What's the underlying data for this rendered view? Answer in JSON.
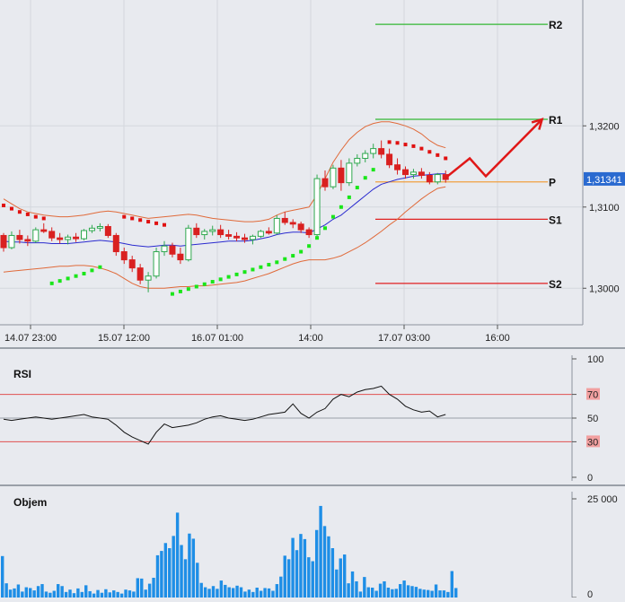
{
  "colors": {
    "background": "#e8eaef",
    "axis_bg": "#e8eaef",
    "grid": "#d4d7dd",
    "candle_up": "#2fa84f",
    "candle_down": "#d92020",
    "ma": "#2a2acf",
    "band": "#e06a3a",
    "sar_up": "#19e619",
    "sar_down": "#e01010",
    "pivot": "#f0a040",
    "resistance": "#33b833",
    "support": "#e02020",
    "arrow": "#e01818",
    "last_price_bg": "#2a6ad0",
    "rsi_line": "#111111",
    "rsi_level": "#e05050",
    "volume": "#1e8ee6"
  },
  "chart_data": [
    {
      "type": "candlestick",
      "name": "price-panel",
      "yticks": [
        "1,3200",
        "1,3100",
        "1,3000"
      ],
      "ylim": [
        1.2955,
        1.3355
      ],
      "last_price_label": "1,31341",
      "last_price": 1.31341,
      "xticks": [
        "14.07 23:00",
        "15.07 12:00",
        "16.07 01:00",
        "14:00",
        "17.07 03:00",
        "16:00"
      ],
      "pivot_levels": [
        {
          "label": "R2",
          "value": 1.3325,
          "kind": "resistance"
        },
        {
          "label": "R1",
          "value": 1.3208,
          "kind": "resistance"
        },
        {
          "label": "P",
          "value": 1.3131,
          "kind": "pivot"
        },
        {
          "label": "S1",
          "value": 1.3085,
          "kind": "support"
        },
        {
          "label": "S2",
          "value": 1.3006,
          "kind": "support"
        }
      ],
      "candles": [
        [
          1.3065,
          1.3068,
          1.3045,
          1.305
        ],
        [
          1.305,
          1.307,
          1.3048,
          1.3065
        ],
        [
          1.3065,
          1.3072,
          1.3055,
          1.306
        ],
        [
          1.306,
          1.3065,
          1.3052,
          1.3058
        ],
        [
          1.3058,
          1.3075,
          1.3056,
          1.3072
        ],
        [
          1.3072,
          1.308,
          1.3068,
          1.307
        ],
        [
          1.307,
          1.3075,
          1.3058,
          1.3062
        ],
        [
          1.3062,
          1.3068,
          1.3055,
          1.306
        ],
        [
          1.306,
          1.3066,
          1.3054,
          1.3063
        ],
        [
          1.3063,
          1.3068,
          1.3057,
          1.3061
        ],
        [
          1.3061,
          1.3073,
          1.3059,
          1.3071
        ],
        [
          1.3071,
          1.3078,
          1.3068,
          1.3074
        ],
        [
          1.3074,
          1.308,
          1.307,
          1.3076
        ],
        [
          1.3076,
          1.3079,
          1.3062,
          1.3065
        ],
        [
          1.3065,
          1.3068,
          1.304,
          1.3045
        ],
        [
          1.3045,
          1.305,
          1.303,
          1.3035
        ],
        [
          1.3035,
          1.304,
          1.302,
          1.3025
        ],
        [
          1.3025,
          1.303,
          1.3005,
          1.301
        ],
        [
          1.301,
          1.302,
          1.2995,
          1.3015
        ],
        [
          1.3015,
          1.305,
          1.3012,
          1.3045
        ],
        [
          1.3045,
          1.3058,
          1.304,
          1.3052
        ],
        [
          1.3052,
          1.3056,
          1.3038,
          1.3042
        ],
        [
          1.3042,
          1.305,
          1.303,
          1.3035
        ],
        [
          1.3035,
          1.3078,
          1.3033,
          1.3074
        ],
        [
          1.3074,
          1.308,
          1.3062,
          1.3066
        ],
        [
          1.3066,
          1.3073,
          1.306,
          1.307
        ],
        [
          1.307,
          1.3077,
          1.3065,
          1.3072
        ],
        [
          1.3072,
          1.3078,
          1.3062,
          1.3066
        ],
        [
          1.3066,
          1.3072,
          1.306,
          1.3064
        ],
        [
          1.3064,
          1.3069,
          1.3058,
          1.3062
        ],
        [
          1.3062,
          1.3067,
          1.3056,
          1.306
        ],
        [
          1.306,
          1.3066,
          1.3054,
          1.3064
        ],
        [
          1.3064,
          1.3072,
          1.3062,
          1.307
        ],
        [
          1.307,
          1.3075,
          1.3066,
          1.3068
        ],
        [
          1.3068,
          1.309,
          1.3066,
          1.3086
        ],
        [
          1.3086,
          1.3094,
          1.3078,
          1.3081
        ],
        [
          1.3081,
          1.3085,
          1.3074,
          1.3079
        ],
        [
          1.3079,
          1.3082,
          1.3068,
          1.3072
        ],
        [
          1.3072,
          1.3075,
          1.3062,
          1.3066
        ],
        [
          1.3066,
          1.314,
          1.3064,
          1.3135
        ],
        [
          1.3135,
          1.3145,
          1.312,
          1.3125
        ],
        [
          1.3125,
          1.3152,
          1.3122,
          1.3148
        ],
        [
          1.3148,
          1.3158,
          1.312,
          1.313
        ],
        [
          1.313,
          1.316,
          1.3126,
          1.3154
        ],
        [
          1.3154,
          1.3165,
          1.315,
          1.316
        ],
        [
          1.316,
          1.317,
          1.3155,
          1.3166
        ],
        [
          1.3166,
          1.3178,
          1.316,
          1.3172
        ],
        [
          1.3172,
          1.3182,
          1.316,
          1.3165
        ],
        [
          1.3165,
          1.3172,
          1.3148,
          1.3152
        ],
        [
          1.3152,
          1.316,
          1.314,
          1.3146
        ],
        [
          1.3146,
          1.315,
          1.3135,
          1.314
        ],
        [
          1.314,
          1.3147,
          1.3135,
          1.3143
        ],
        [
          1.3143,
          1.3148,
          1.3135,
          1.3139
        ],
        [
          1.3139,
          1.3143,
          1.3128,
          1.3131
        ],
        [
          1.3131,
          1.3142,
          1.3128,
          1.314
        ],
        [
          1.314,
          1.3145,
          1.313,
          1.3134
        ]
      ],
      "moving_average": [
        1.3058,
        1.3057,
        1.3057,
        1.3056,
        1.3056,
        1.3056,
        1.3055,
        1.3055,
        1.3055,
        1.3056,
        1.3057,
        1.3058,
        1.3059,
        1.3058,
        1.3057,
        1.3055,
        1.3053,
        1.3052,
        1.3051,
        1.3052,
        1.3053,
        1.3053,
        1.3052,
        1.3053,
        1.3054,
        1.3055,
        1.3056,
        1.3057,
        1.3058,
        1.3058,
        1.3058,
        1.3059,
        1.3061,
        1.3063,
        1.3066,
        1.3068,
        1.3069,
        1.3069,
        1.3068,
        1.3073,
        1.3078,
        1.3085,
        1.309,
        1.3098,
        1.3106,
        1.3114,
        1.3122,
        1.3128,
        1.3131,
        1.3134,
        1.3136,
        1.3138,
        1.3139,
        1.314,
        1.3141,
        1.3141
      ],
      "band_upper": [
        1.311,
        1.3104,
        1.3098,
        1.3094,
        1.3092,
        1.309,
        1.3089,
        1.3088,
        1.3088,
        1.3089,
        1.309,
        1.3092,
        1.3094,
        1.3095,
        1.3094,
        1.3092,
        1.309,
        1.3088,
        1.3086,
        1.3087,
        1.3088,
        1.3089,
        1.309,
        1.3091,
        1.309,
        1.3088,
        1.3086,
        1.3085,
        1.3084,
        1.3083,
        1.3082,
        1.3082,
        1.3083,
        1.3085,
        1.309,
        1.3094,
        1.3096,
        1.3098,
        1.31,
        1.3115,
        1.3135,
        1.3155,
        1.317,
        1.3183,
        1.3192,
        1.3199,
        1.3203,
        1.3205,
        1.3205,
        1.3203,
        1.32,
        1.3196,
        1.319,
        1.3182,
        1.3176,
        1.3173
      ],
      "band_lower": [
        1.302,
        1.3021,
        1.3022,
        1.3023,
        1.3024,
        1.3025,
        1.3026,
        1.3027,
        1.3027,
        1.3028,
        1.3028,
        1.3027,
        1.3025,
        1.3022,
        1.3018,
        1.3012,
        1.3006,
        1.3002,
        1.3,
        1.3,
        1.3,
        1.3001,
        1.3002,
        1.3002,
        1.3003,
        1.3003,
        1.3004,
        1.3005,
        1.3006,
        1.3007,
        1.3009,
        1.3012,
        1.3015,
        1.3018,
        1.3022,
        1.3026,
        1.303,
        1.3033,
        1.3035,
        1.3035,
        1.3035,
        1.3037,
        1.304,
        1.3045,
        1.305,
        1.3056,
        1.3063,
        1.307,
        1.3078,
        1.3085,
        1.3094,
        1.3102,
        1.311,
        1.3117,
        1.3123,
        1.3125
      ],
      "parabolic_sar": [
        {
          "i": 0,
          "v": 1.3102,
          "dir": "down"
        },
        {
          "i": 1,
          "v": 1.3098,
          "dir": "down"
        },
        {
          "i": 2,
          "v": 1.3094,
          "dir": "down"
        },
        {
          "i": 3,
          "v": 1.3091,
          "dir": "down"
        },
        {
          "i": 4,
          "v": 1.3088,
          "dir": "down"
        },
        {
          "i": 5,
          "v": 1.3086,
          "dir": "down"
        },
        {
          "i": 6,
          "v": 1.3006,
          "dir": "up"
        },
        {
          "i": 7,
          "v": 1.3009,
          "dir": "up"
        },
        {
          "i": 8,
          "v": 1.3012,
          "dir": "up"
        },
        {
          "i": 9,
          "v": 1.3015,
          "dir": "up"
        },
        {
          "i": 10,
          "v": 1.3018,
          "dir": "up"
        },
        {
          "i": 11,
          "v": 1.3022,
          "dir": "up"
        },
        {
          "i": 12,
          "v": 1.3026,
          "dir": "up"
        },
        {
          "i": 15,
          "v": 1.3088,
          "dir": "down"
        },
        {
          "i": 16,
          "v": 1.3086,
          "dir": "down"
        },
        {
          "i": 17,
          "v": 1.3084,
          "dir": "down"
        },
        {
          "i": 18,
          "v": 1.3082,
          "dir": "down"
        },
        {
          "i": 19,
          "v": 1.308,
          "dir": "down"
        },
        {
          "i": 20,
          "v": 1.3078,
          "dir": "down"
        },
        {
          "i": 21,
          "v": 1.2993,
          "dir": "up"
        },
        {
          "i": 22,
          "v": 1.2996,
          "dir": "up"
        },
        {
          "i": 23,
          "v": 1.2999,
          "dir": "up"
        },
        {
          "i": 24,
          "v": 1.3002,
          "dir": "up"
        },
        {
          "i": 25,
          "v": 1.3005,
          "dir": "up"
        },
        {
          "i": 26,
          "v": 1.3008,
          "dir": "up"
        },
        {
          "i": 27,
          "v": 1.3011,
          "dir": "up"
        },
        {
          "i": 28,
          "v": 1.3014,
          "dir": "up"
        },
        {
          "i": 29,
          "v": 1.3017,
          "dir": "up"
        },
        {
          "i": 30,
          "v": 1.302,
          "dir": "up"
        },
        {
          "i": 31,
          "v": 1.3023,
          "dir": "up"
        },
        {
          "i": 32,
          "v": 1.3026,
          "dir": "up"
        },
        {
          "i": 33,
          "v": 1.3029,
          "dir": "up"
        },
        {
          "i": 34,
          "v": 1.3032,
          "dir": "up"
        },
        {
          "i": 35,
          "v": 1.3036,
          "dir": "up"
        },
        {
          "i": 36,
          "v": 1.304,
          "dir": "up"
        },
        {
          "i": 37,
          "v": 1.3045,
          "dir": "up"
        },
        {
          "i": 38,
          "v": 1.3052,
          "dir": "up"
        },
        {
          "i": 39,
          "v": 1.3062,
          "dir": "up"
        },
        {
          "i": 40,
          "v": 1.3074,
          "dir": "up"
        },
        {
          "i": 41,
          "v": 1.3088,
          "dir": "up"
        },
        {
          "i": 42,
          "v": 1.31,
          "dir": "up"
        },
        {
          "i": 43,
          "v": 1.3112,
          "dir": "up"
        },
        {
          "i": 44,
          "v": 1.3124,
          "dir": "up"
        },
        {
          "i": 45,
          "v": 1.3136,
          "dir": "up"
        },
        {
          "i": 46,
          "v": 1.3146,
          "dir": "up"
        },
        {
          "i": 48,
          "v": 1.318,
          "dir": "down"
        },
        {
          "i": 49,
          "v": 1.3179,
          "dir": "down"
        },
        {
          "i": 50,
          "v": 1.3177,
          "dir": "down"
        },
        {
          "i": 51,
          "v": 1.3175,
          "dir": "down"
        },
        {
          "i": 52,
          "v": 1.3172,
          "dir": "down"
        },
        {
          "i": 53,
          "v": 1.3168,
          "dir": "down"
        },
        {
          "i": 54,
          "v": 1.3164,
          "dir": "down"
        },
        {
          "i": 55,
          "v": 1.316,
          "dir": "down"
        }
      ],
      "forecast_arrow": [
        [
          1.3136,
          55
        ],
        [
          1.316,
          58
        ],
        [
          1.3138,
          60
        ],
        [
          1.3208,
          67
        ]
      ]
    },
    {
      "type": "line",
      "name": "rsi-panel",
      "title": "RSI",
      "yticks": [
        "100",
        "70",
        "50",
        "30",
        "0"
      ],
      "ylim": [
        0,
        100
      ],
      "levels": [
        70,
        50,
        30
      ],
      "values": [
        49,
        48,
        49,
        50,
        51,
        50,
        49,
        50,
        51,
        52,
        53,
        51,
        50,
        49,
        44,
        38,
        34,
        31,
        28,
        38,
        45,
        42,
        43,
        44,
        46,
        49,
        51,
        52,
        50,
        49,
        48,
        49,
        51,
        53,
        54,
        55,
        62,
        54,
        50,
        55,
        58,
        66,
        70,
        68,
        72,
        74,
        75,
        77,
        70,
        66,
        60,
        57,
        55,
        56,
        51,
        53
      ]
    },
    {
      "type": "bar",
      "name": "volume-panel",
      "title": "Objem",
      "yticks": [
        "25 000",
        "0"
      ],
      "ylim": [
        0,
        25000
      ],
      "values": [
        10500,
        3600,
        2000,
        2300,
        3300,
        1500,
        2600,
        2400,
        1800,
        2900,
        3400,
        1500,
        1200,
        1700,
        3400,
        2900,
        1400,
        2000,
        1100,
        2300,
        1400,
        3100,
        1600,
        1000,
        1900,
        1200,
        2100,
        1300,
        1800,
        1400,
        1000,
        2000,
        1800,
        1500,
        4900,
        4800,
        2000,
        3500,
        5000,
        10700,
        11800,
        13800,
        12500,
        15600,
        21500,
        13300,
        9700,
        16200,
        14900,
        8800,
        3700,
        2600,
        2200,
        2900,
        2200,
        4300,
        3200,
        2600,
        2400,
        3000,
        2600,
        1500,
        2000,
        1400,
        2500,
        1700,
        2400,
        2300,
        1700,
        3400,
        5300,
        10600,
        9700,
        15100,
        12000,
        16100,
        14800,
        10200,
        9200,
        17100,
        23200,
        18100,
        15500,
        12500,
        7100,
        9900,
        10900,
        3600,
        6600,
        4100,
        1500,
        5200,
        2600,
        2500,
        1700,
        3500,
        4100,
        2500,
        2100,
        2200,
        3400,
        4300,
        3100,
        2900,
        2700,
        2200,
        2000,
        1900,
        1700,
        3300,
        1800,
        1800,
        1400,
        6700,
        2400
      ]
    }
  ]
}
